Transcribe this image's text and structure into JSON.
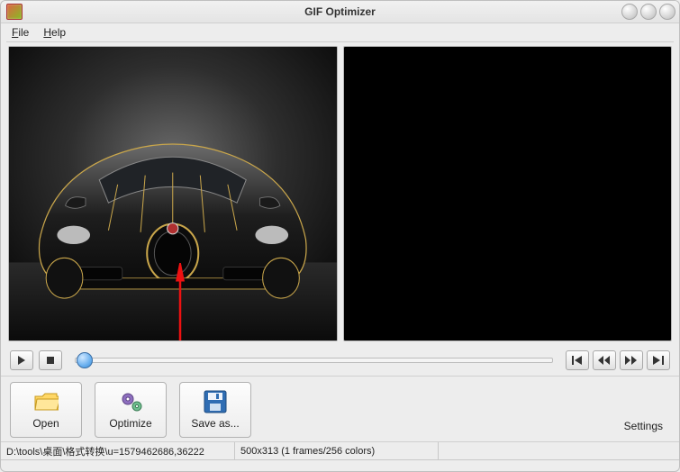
{
  "window": {
    "title": "GIF Optimizer"
  },
  "menu": {
    "file": "File",
    "help": "Help"
  },
  "playback": {
    "play_glyph": "▸",
    "stop_glyph": "■",
    "first_glyph": "⏮",
    "prev_glyph": "⏪",
    "next_glyph": "⏩",
    "last_glyph": "⏭"
  },
  "toolbar": {
    "open": "Open",
    "optimize": "Optimize",
    "save_as": "Save as...",
    "settings": "Settings"
  },
  "status": {
    "path": "D:\\tools\\桌面\\格式转换\\u=1579462686,36222",
    "info": "500x313 (1 frames/256 colors)"
  },
  "icons": {
    "app": "app-icon",
    "minimize": "minimize",
    "maximize": "maximize",
    "close": "close",
    "folder": "folder",
    "gears": "gears",
    "floppy": "floppy"
  }
}
